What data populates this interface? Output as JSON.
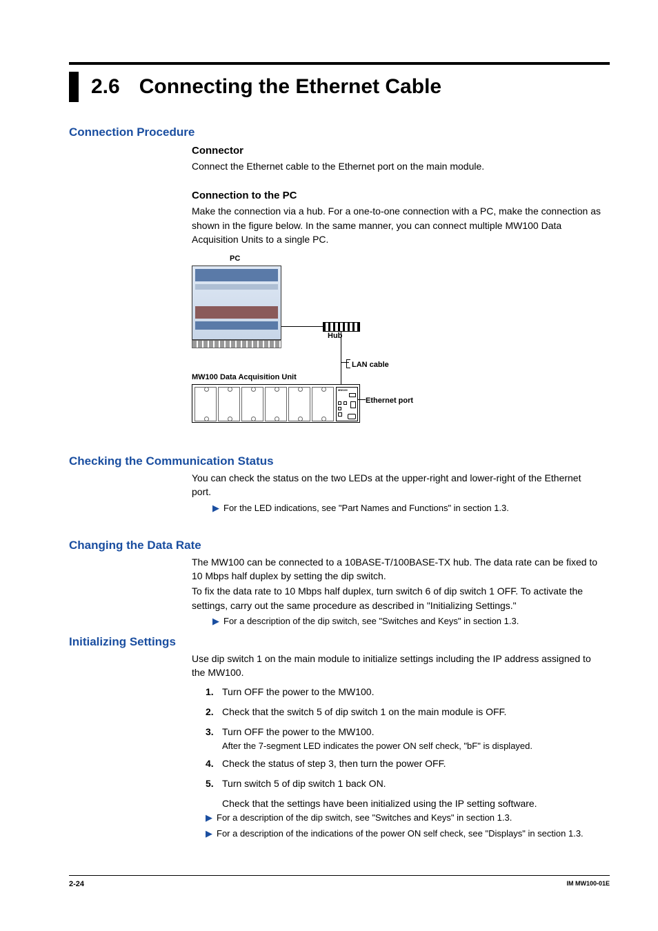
{
  "chapter": {
    "number": "2.6",
    "title": "Connecting the Ethernet Cable"
  },
  "s1": {
    "heading": "Connection Procedure",
    "sub1": {
      "heading": "Connector",
      "body": "Connect the Ethernet cable to the Ethernet port on the main module."
    },
    "sub2": {
      "heading": "Connection to the PC",
      "body": "Make the connection via a hub. For a one-to-one connection with a PC, make the connection as shown in the figure below. In the same manner, you can connect multiple MW100 Data Acquisition Units to a single PC."
    }
  },
  "fig": {
    "pc": "PC",
    "hub": "Hub",
    "lan": "LAN cable",
    "mw": "MW100 Data Acquisition Unit",
    "eth": "Ethernet port",
    "mwtag": "MW100"
  },
  "s2": {
    "heading": "Checking the Communication Status",
    "body": "You can check the status on the two LEDs at the upper-right and lower-right of the Ethernet port.",
    "ref": "For the LED indications, see \"Part Names and Functions\" in section 1.3."
  },
  "s3": {
    "heading": "Changing the Data Rate",
    "body1": "The MW100 can be connected to a 10BASE-T/100BASE-TX hub. The data rate can be fixed to 10 Mbps half duplex by setting the dip switch.",
    "body2": "To fix the data rate to 10 Mbps half duplex, turn switch 6 of dip switch 1 OFF. To activate the settings, carry out the same procedure as described in \"Initializing Settings.\"",
    "ref": "For a description of the dip switch, see \"Switches and Keys\" in section 1.3."
  },
  "s4": {
    "heading": "Initializing Settings",
    "body": "Use dip switch 1 on the main module to initialize settings including the IP address assigned to the MW100.",
    "steps": [
      "Turn OFF the power to the MW100.",
      "Check that the switch 5 of dip switch 1 on the main module is OFF.",
      "Turn OFF the power to the MW100.",
      "Check the status of step 3, then turn the power OFF.",
      "Turn switch 5 of dip switch 1 back ON."
    ],
    "step3sub": "After the 7-segment LED indicates the power ON self check, \"bF\" is displayed.",
    "step5cont": "Check that the settings have been initialized using the IP setting software.",
    "ref1": "For a description of the dip switch, see \"Switches and Keys\" in section 1.3.",
    "ref2": "For a description of the indications of the power ON self check, see \"Displays\" in section 1.3."
  },
  "footer": {
    "page": "2-24",
    "doc": "IM MW100-01E"
  }
}
